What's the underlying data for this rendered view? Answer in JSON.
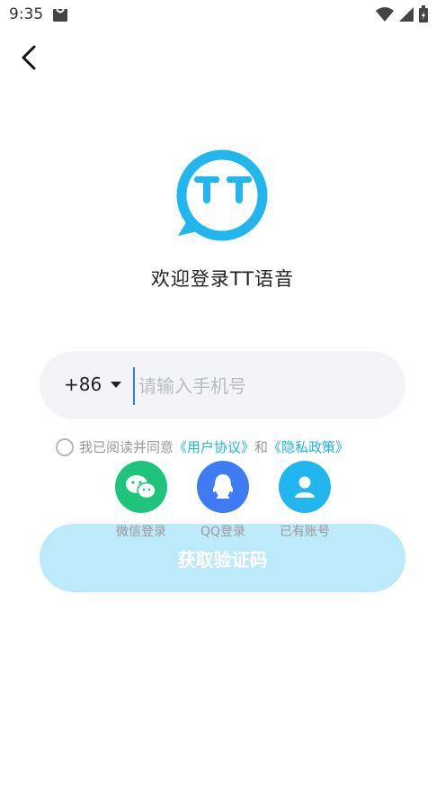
{
  "status_bar": {
    "time": "9:35"
  },
  "welcome_text": "欢迎登录TT语音",
  "phone": {
    "country_code": "+86",
    "placeholder": "请输入手机号",
    "value": ""
  },
  "agreement": {
    "prefix": "我已阅读并同意",
    "user_agreement": "《用户协议》",
    "and": "和",
    "privacy_policy": "《隐私政策》"
  },
  "get_code_label": "获取验证码",
  "social": [
    {
      "label": "微信登录",
      "icon": "wechat-icon",
      "color": "#1fc47c"
    },
    {
      "label": "QQ登录",
      "icon": "qq-icon",
      "color": "#3f7cf4"
    },
    {
      "label": "已有账号",
      "icon": "user-icon",
      "color": "#22b6ef"
    }
  ],
  "colors": {
    "accent": "#1fb4e8",
    "logo": "#22b6ef",
    "button": "#bdeafb"
  }
}
